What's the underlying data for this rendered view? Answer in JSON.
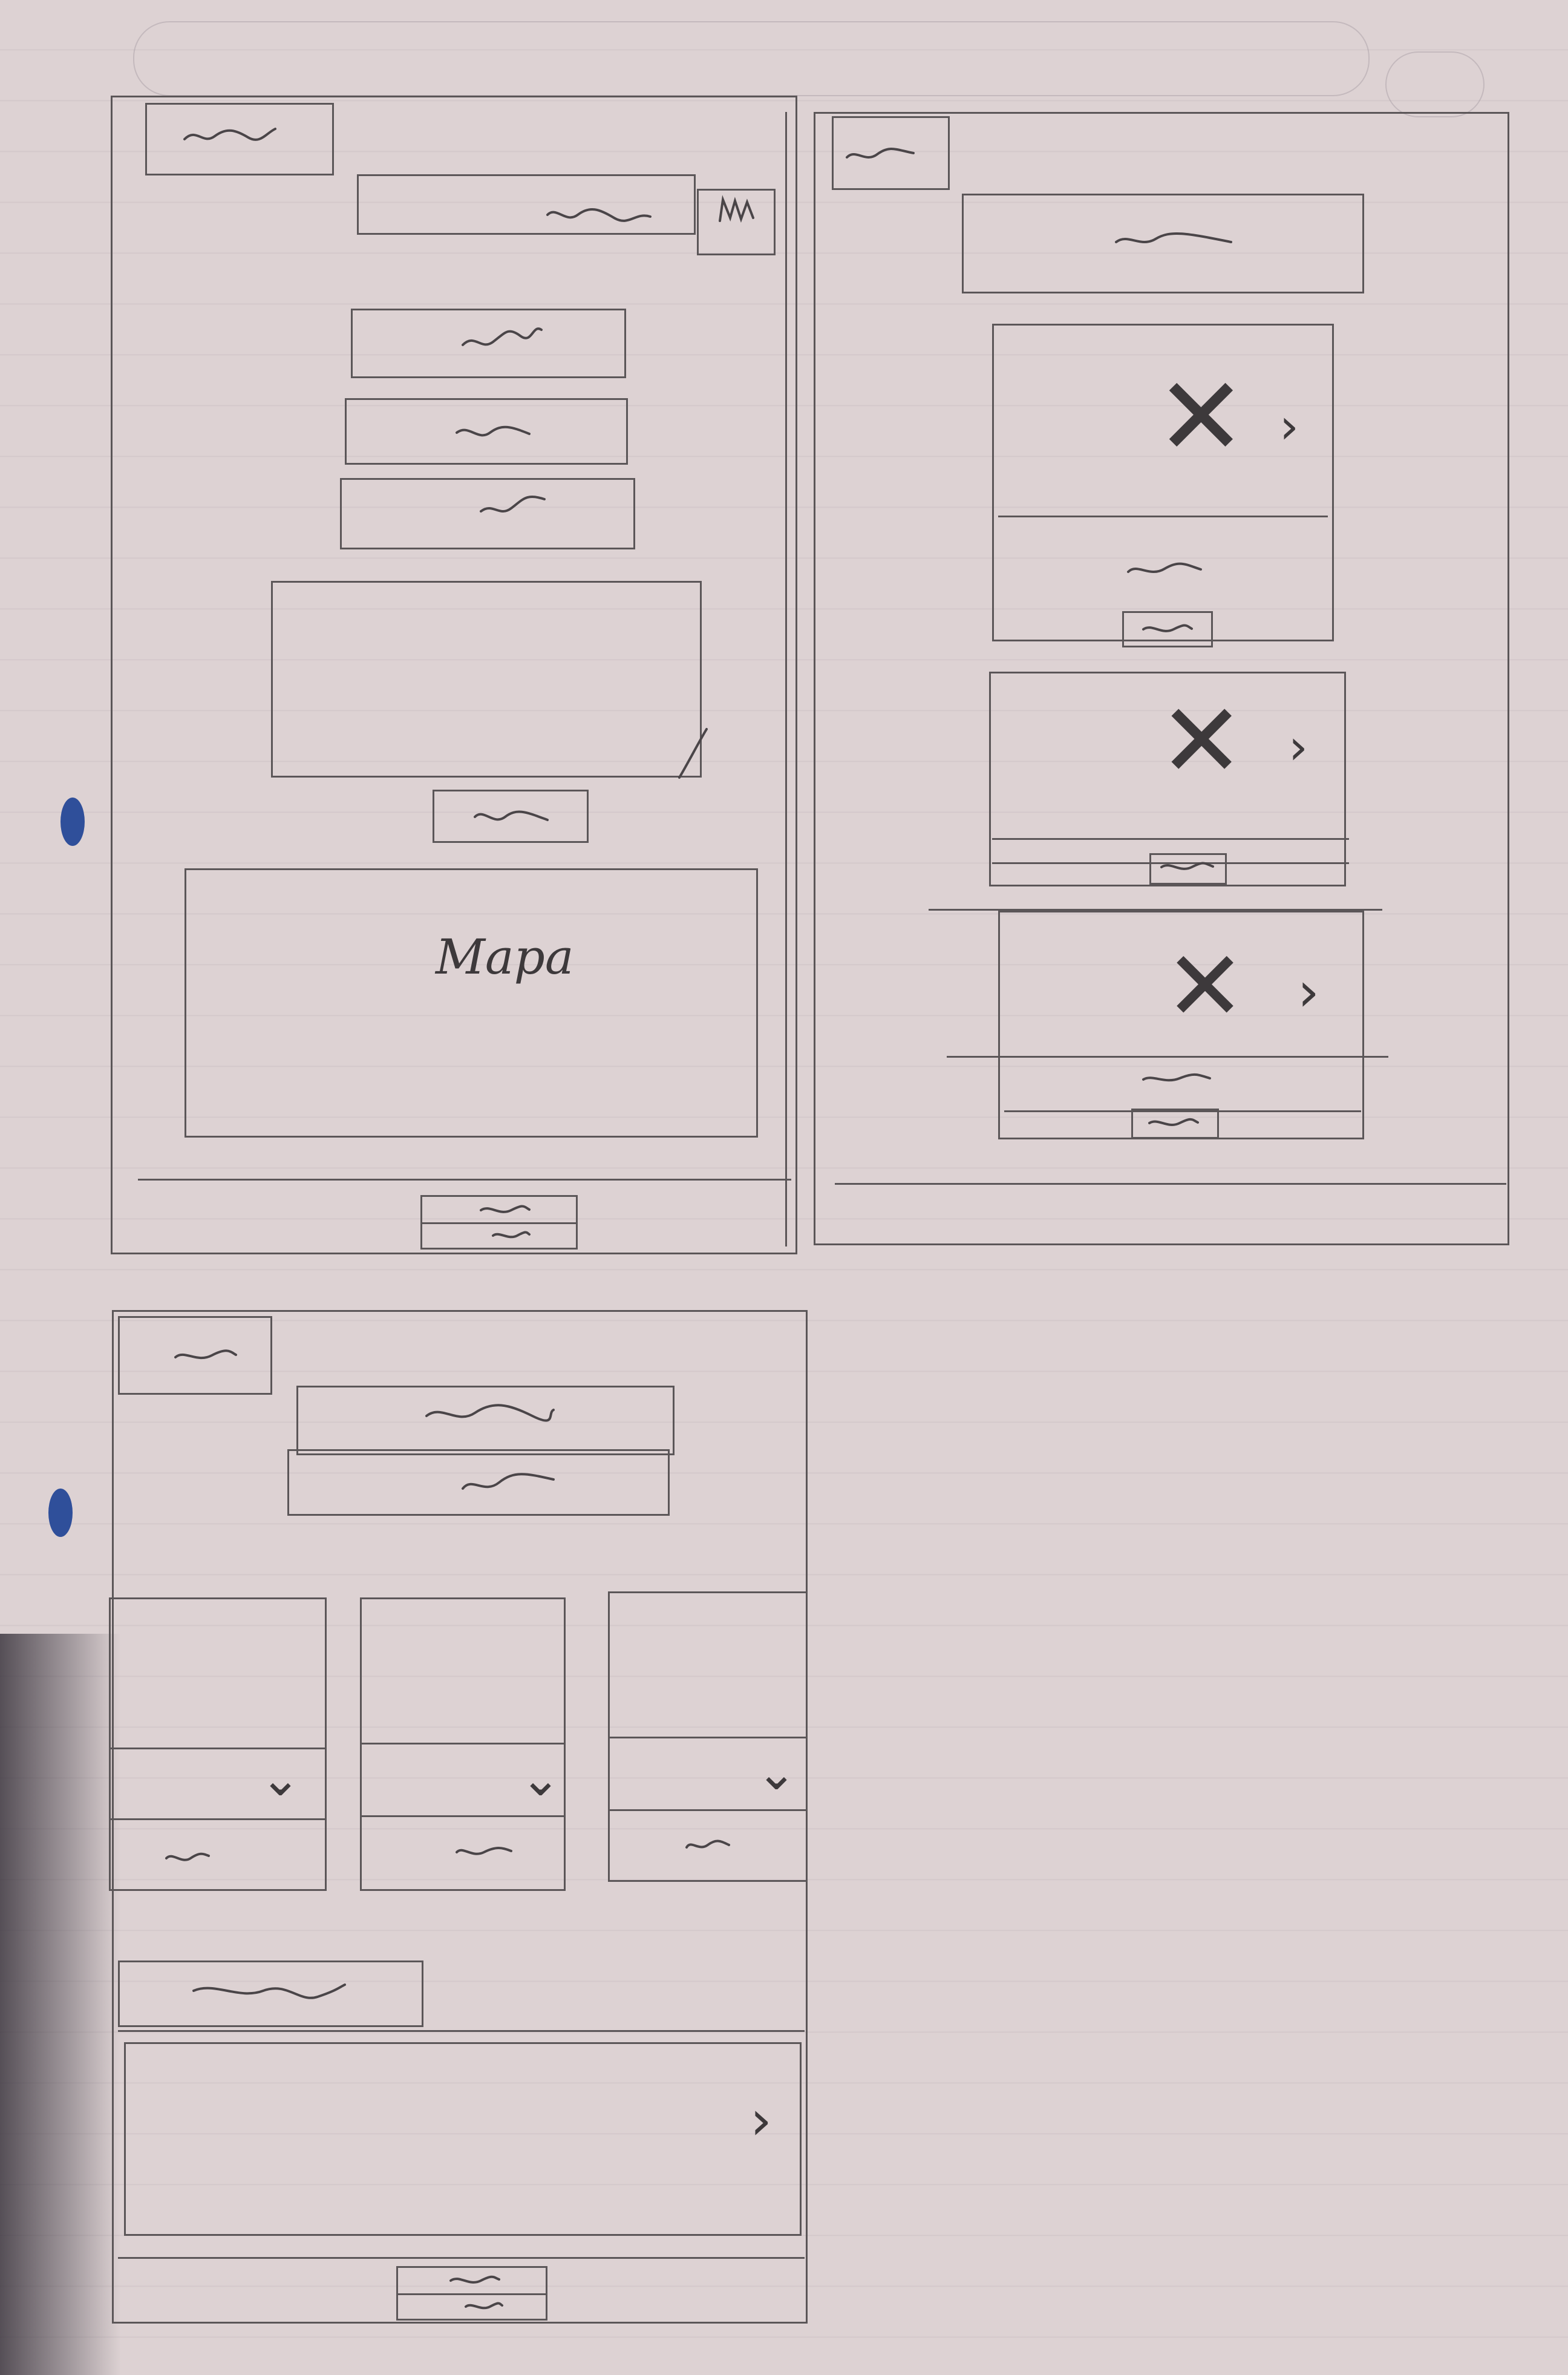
{
  "sketch": {
    "map_label": "Mapa",
    "icons": {
      "close": "close-icon",
      "chevron_right": "chevron-right-icon",
      "chevron_down": "chevron-down-icon"
    },
    "colors": {
      "paper": "#ddd2d3",
      "pencil": "#5b5658",
      "punch_hole": "#2f4f9a"
    }
  }
}
